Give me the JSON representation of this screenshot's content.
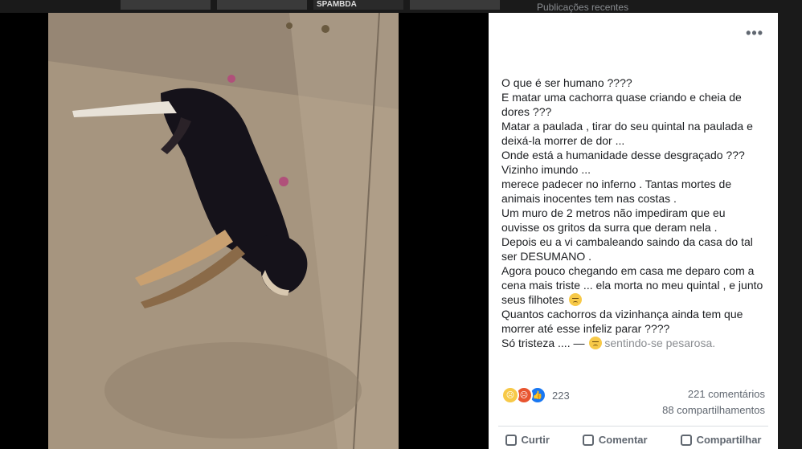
{
  "background": {
    "recent_label": "Publicações recentes",
    "strip_text": "SPAMBDA"
  },
  "post": {
    "more_label": "•••",
    "lines": [
      "O que é ser humano ????",
      "E matar uma cachorra quase criando e cheia de",
      "dores ???",
      "Matar a paulada , tirar do seu quintal na paulada e",
      "deixá-la morrer de dor ...",
      "Onde está a humanidade desse desgraçado ???",
      "Vizinho imundo ...",
      "merece padecer no inferno . Tantas mortes de",
      "animais inocentes tem nas costas .",
      "Um muro de 2 metros não impediram que eu",
      "ouvisse os gritos da surra que deram nela .",
      "Depois eu a vi cambaleando saindo da casa do tal",
      "ser DESUMANO .",
      "Agora pouco chegando em casa me deparo com a",
      "cena mais triste ... ela morta no meu quintal , e junto",
      "seus filhotes",
      "Quantos cachorros da vizinhança ainda tem que",
      "morrer até esse infeliz parar ????",
      "Só tristeza .... —"
    ],
    "feeling": "sentindo-se pesarosa."
  },
  "stats": {
    "reaction_count": "223",
    "comments": "221 comentários",
    "shares": "88 compartilhamentos"
  },
  "actions": {
    "like": "Curtir",
    "comment": "Comentar",
    "share": "Compartilhar"
  },
  "icons": {
    "sad_emoji": "sad-face-icon",
    "reactions": [
      "sad-reaction-icon",
      "angry-reaction-icon",
      "like-reaction-icon"
    ]
  },
  "colors": {
    "like_blue": "#1877f2",
    "angry": "#e8542f",
    "sad_yellow": "#f7c948",
    "text_gray": "#606770"
  }
}
